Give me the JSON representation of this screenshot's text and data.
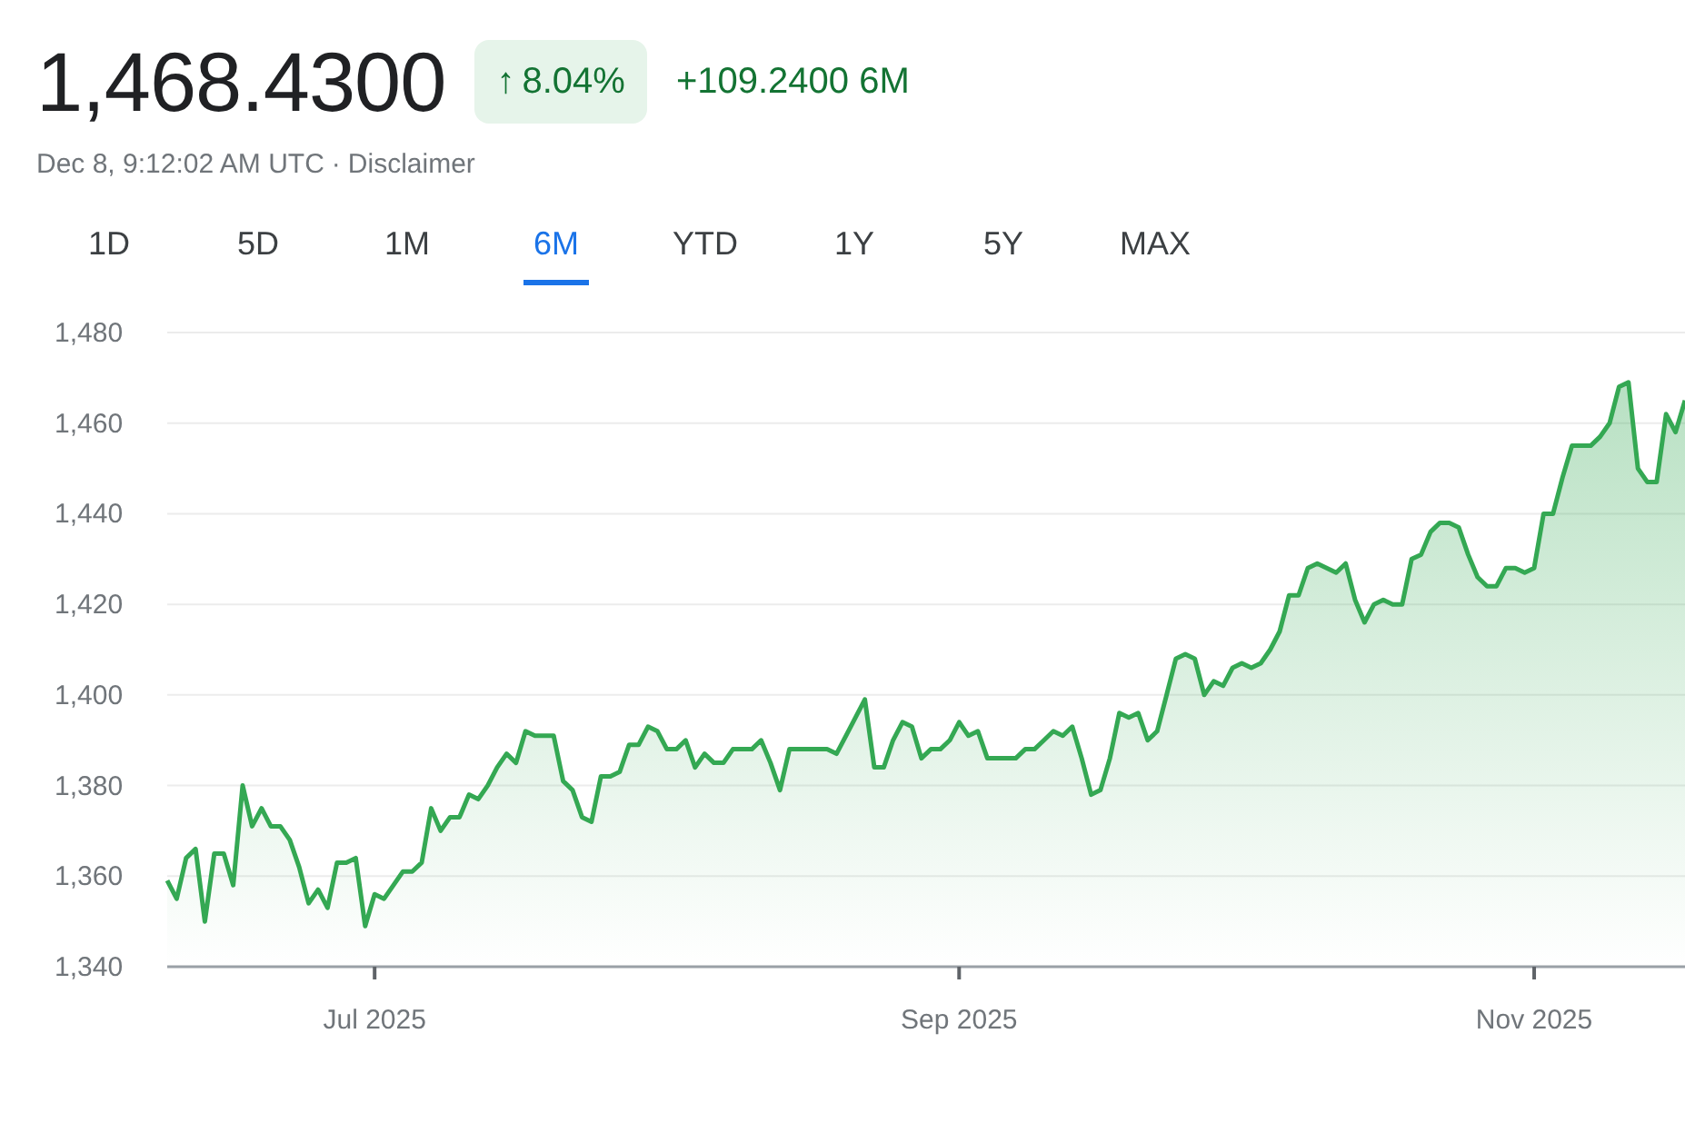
{
  "quote": {
    "price": "1,468.4300",
    "change_arrow": "↑",
    "change_percent": "8.04%",
    "change_value": "+109.2400 6M",
    "timestamp": "Dec 8, 9:12:02 AM UTC",
    "separator": "·",
    "disclaimer": "Disclaimer"
  },
  "tabs": [
    {
      "label": "1D",
      "selected": false
    },
    {
      "label": "5D",
      "selected": false
    },
    {
      "label": "1M",
      "selected": false
    },
    {
      "label": "6M",
      "selected": true
    },
    {
      "label": "YTD",
      "selected": false
    },
    {
      "label": "1Y",
      "selected": false
    },
    {
      "label": "5Y",
      "selected": false
    },
    {
      "label": "MAX",
      "selected": false
    }
  ],
  "chart": {
    "chart_data": {
      "type": "area",
      "grid": true,
      "categories": [
        null,
        null,
        null,
        null,
        null,
        null,
        null,
        null,
        null,
        null,
        null,
        null,
        null,
        null,
        null,
        null,
        null,
        null,
        null,
        null,
        null,
        null,
        "Jul 2025",
        null,
        null,
        null,
        null,
        null,
        null,
        null,
        null,
        null,
        null,
        null,
        null,
        null,
        null,
        null,
        null,
        null,
        null,
        null,
        null,
        null,
        null,
        null,
        null,
        null,
        null,
        null,
        null,
        null,
        null,
        null,
        null,
        null,
        null,
        null,
        null,
        null,
        null,
        null,
        null,
        null,
        null,
        null,
        null,
        null,
        null,
        null,
        null,
        null,
        null,
        null,
        null,
        null,
        null,
        null,
        null,
        null,
        null,
        null,
        null,
        null,
        "Sep 2025",
        null,
        null,
        null,
        null,
        null,
        null,
        null,
        null,
        null,
        null,
        null,
        null,
        null,
        null,
        null,
        null,
        null,
        null,
        null,
        null,
        null,
        null,
        null,
        null,
        null,
        null,
        null,
        null,
        null,
        null,
        null,
        null,
        null,
        null,
        null,
        null,
        null,
        null,
        null,
        null,
        null,
        null,
        null,
        null,
        null,
        null,
        null,
        null,
        null,
        null,
        null,
        null,
        null,
        null,
        null,
        null,
        null,
        null,
        null,
        null,
        "Nov 2025",
        null,
        null,
        null,
        null,
        null,
        null,
        null,
        null,
        null,
        null,
        null,
        null,
        null,
        null,
        null,
        null
      ],
      "ylim": [
        1340,
        1480
      ],
      "yticks": [
        {
          "value": 1340,
          "label": "1,340"
        },
        {
          "value": 1360,
          "label": "1,360"
        },
        {
          "value": 1380,
          "label": "1,380"
        },
        {
          "value": 1400,
          "label": "1,400"
        },
        {
          "value": 1420,
          "label": "1,420"
        },
        {
          "value": 1440,
          "label": "1,440"
        },
        {
          "value": 1460,
          "label": "1,460"
        },
        {
          "value": 1480,
          "label": "1,480"
        }
      ],
      "series": [
        {
          "color": "#34a853",
          "values": [
            1359,
            1355,
            1364,
            1366,
            1350,
            1365,
            1365,
            1358,
            1380,
            1371,
            1375,
            1371,
            1371,
            1368,
            1362,
            1354,
            1357,
            1353,
            1363,
            1363,
            1364,
            1349,
            1356,
            1355,
            1358,
            1361,
            1361,
            1363,
            1375,
            1370,
            1373,
            1373,
            1378,
            1377,
            1380,
            1384,
            1387,
            1385,
            1392,
            1391,
            1391,
            1391,
            1381,
            1379,
            1373,
            1372,
            1382,
            1382,
            1383,
            1389,
            1389,
            1393,
            1392,
            1388,
            1388,
            1390,
            1384,
            1387,
            1385,
            1385,
            1388,
            1388,
            1388,
            1390,
            1385,
            1379,
            1388,
            1388,
            1388,
            1388,
            1388,
            1387,
            1391,
            1395,
            1399,
            1384,
            1384,
            1390,
            1394,
            1393,
            1386,
            1388,
            1388,
            1390,
            1394,
            1391,
            1392,
            1386,
            1386,
            1386,
            1386,
            1388,
            1388,
            1390,
            1392,
            1391,
            1393,
            1386,
            1378,
            1379,
            1386,
            1396,
            1395,
            1396,
            1390,
            1392,
            1400,
            1408,
            1409,
            1408,
            1400,
            1403,
            1402,
            1406,
            1407,
            1406,
            1407,
            1410,
            1414,
            1422,
            1422,
            1428,
            1429,
            1428,
            1427,
            1429,
            1421,
            1416,
            1420,
            1421,
            1420,
            1420,
            1430,
            1431,
            1436,
            1438,
            1438,
            1437,
            1431,
            1426,
            1424,
            1424,
            1428,
            1428,
            1427,
            1428,
            1440,
            1440,
            1448,
            1455,
            1455,
            1455,
            1457,
            1460,
            1468,
            1469,
            1450,
            1447,
            1447,
            1462,
            1458,
            1465
          ]
        }
      ]
    }
  }
}
